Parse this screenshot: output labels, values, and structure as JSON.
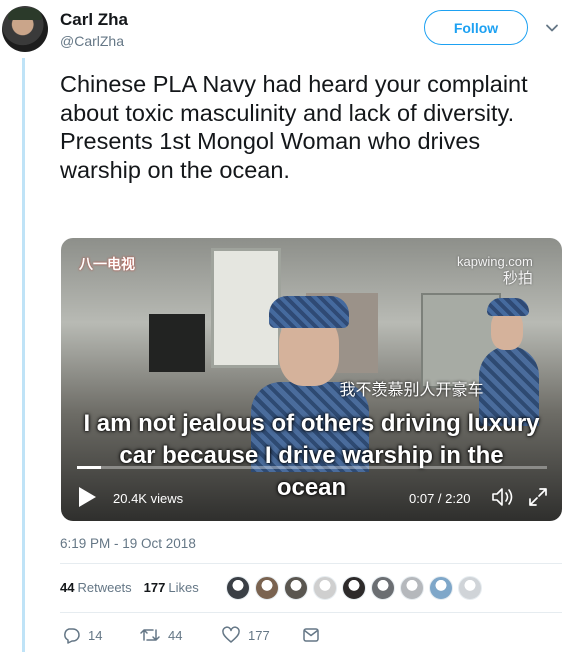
{
  "author": {
    "name": "Carl Zha",
    "handle": "@CarlZha"
  },
  "follow_label": "Follow",
  "tweet": {
    "text": "Chinese PLA Navy had heard your complaint about toxic masculinity and lack of diversity. Presents 1st Mongol Woman who drives warship on the ocean."
  },
  "video": {
    "channel_logo": "八一电视",
    "watermark": "kapwing.com",
    "watermark_logo": "秒拍",
    "subtitle_cn": "我不羡慕别人开豪车",
    "subtitle_en": "I am not jealous of others driving luxury car because I drive warship in the ocean",
    "views": "20.4K views",
    "time": "0:07 / 2:20",
    "progress_fraction": 0.05
  },
  "timestamp": "6:19 PM - 19 Oct 2018",
  "stats": {
    "retweets_count": "44",
    "retweets_label": "Retweets",
    "likes_count": "177",
    "likes_label": "Likes"
  },
  "liker_avatar_colors": [
    "#3a3f45",
    "#7a6350",
    "#5a5650",
    "#cfcfcf",
    "#2d2a2a",
    "#6b6e72",
    "#b5b8bc",
    "#7fa7c9",
    "#d0d4d8"
  ],
  "actions": {
    "reply_count": "14",
    "retweet_count": "44",
    "like_count": "177"
  },
  "colors": {
    "accent": "#1da1f2",
    "secondary_text": "#657786",
    "thread_line": "#bfe3f7"
  },
  "icons": [
    "chevron-down-icon",
    "play-icon",
    "volume-icon",
    "fullscreen-icon",
    "reply-icon",
    "retweet-icon",
    "like-icon",
    "direct-message-icon"
  ]
}
